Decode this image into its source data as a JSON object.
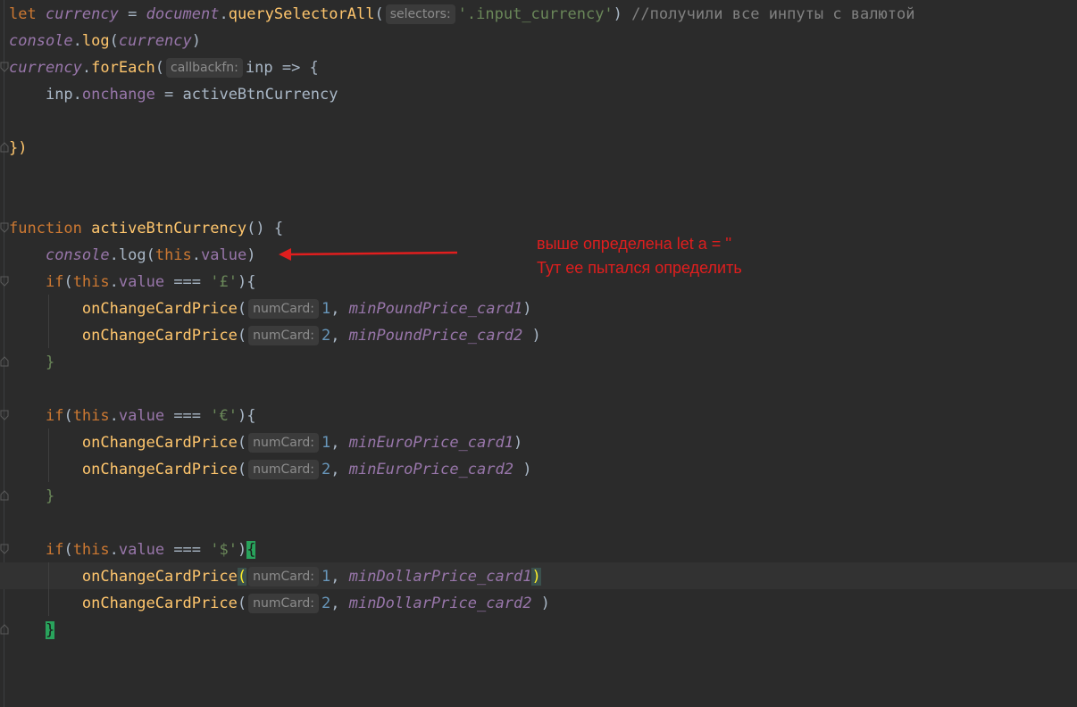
{
  "code": {
    "l1": {
      "kw": "let",
      "var": "currency",
      "eq": " = ",
      "obj": "document",
      "dot": ".",
      "fn": "querySelectorAll",
      "open": "(",
      "hint": "selectors:",
      "str": "'.input_currency'",
      "close": ")",
      "comment": "//получили все инпуты с валютой"
    },
    "l2": {
      "obj": "console",
      "dot": ".",
      "fn": "log",
      "open": "(",
      "var": "currency",
      "close": ")"
    },
    "l3": {
      "var": "currency",
      "dot": ".",
      "fn": "forEach",
      "open": "(",
      "hint": "callbackfn:",
      "rest": "inp => {"
    },
    "l4": {
      "obj": "inp",
      "dot": ".",
      "prop": "onchange",
      "rest": " = activeBtnCurrency"
    },
    "l6": {
      "text": "})"
    },
    "l9": {
      "kw": "function",
      "fn": "activeBtnCurrency",
      "rest": "() {"
    },
    "l10": {
      "obj": "console",
      "dot": ".",
      "fn": "log",
      "open": "(",
      "this": "this",
      "dot2": ".",
      "prop": "value",
      "close": ")"
    },
    "if_pound": {
      "kw": "if",
      "open": "(",
      "this": "this",
      "dot": ".",
      "prop": "value",
      "op": " === ",
      "str": "'£'",
      "close": "){"
    },
    "pound1": {
      "fn": "onChangeCardPrice",
      "open": "(",
      "hint": "numCard:",
      "num": "1",
      "comma": ", ",
      "var": "minPoundPrice_card1",
      "close": ")"
    },
    "pound2": {
      "fn": "onChangeCardPrice",
      "open": "(",
      "hint": "numCard:",
      "num": "2",
      "comma": ", ",
      "var": "minPoundPrice_card2",
      "close": " )"
    },
    "close_pound": {
      "text": "}"
    },
    "if_euro": {
      "kw": "if",
      "open": "(",
      "this": "this",
      "dot": ".",
      "prop": "value",
      "op": " === ",
      "str": "'€'",
      "close": "){"
    },
    "euro1": {
      "fn": "onChangeCardPrice",
      "open": "(",
      "hint": "numCard:",
      "num": "1",
      "comma": ", ",
      "var": "minEuroPrice_card1",
      "close": ")"
    },
    "euro2": {
      "fn": "onChangeCardPrice",
      "open": "(",
      "hint": "numCard:",
      "num": "2",
      "comma": ", ",
      "var": "minEuroPrice_card2",
      "close": " )"
    },
    "close_euro": {
      "text": "}"
    },
    "if_dollar": {
      "kw": "if",
      "open": "(",
      "this": "this",
      "dot": ".",
      "prop": "value",
      "op": " === ",
      "str": "'$'",
      "close1": ")",
      "brace": "{"
    },
    "dollar1": {
      "fn": "onChangeCardPrice",
      "open": "(",
      "hint": "numCard:",
      "num": "1",
      "comma": ", ",
      "var": "minDollarPrice_card1",
      "close": ")"
    },
    "dollar2": {
      "fn": "onChangeCardPrice",
      "open": "(",
      "hint": "numCard:",
      "num": "2",
      "comma": ", ",
      "var": "minDollarPrice_card2",
      "close": " )"
    },
    "close_dollar": {
      "text": "}"
    }
  },
  "annotation": {
    "line1": "выше определена let a = ''",
    "line2": "Тут ее пытался определить"
  },
  "colors": {
    "background": "#2b2b2b",
    "keyword": "#cc7832",
    "function": "#ffc66d",
    "string": "#6a8759",
    "number": "#6897bb",
    "variable": "#9876aa",
    "annotation": "#e01e1e"
  }
}
